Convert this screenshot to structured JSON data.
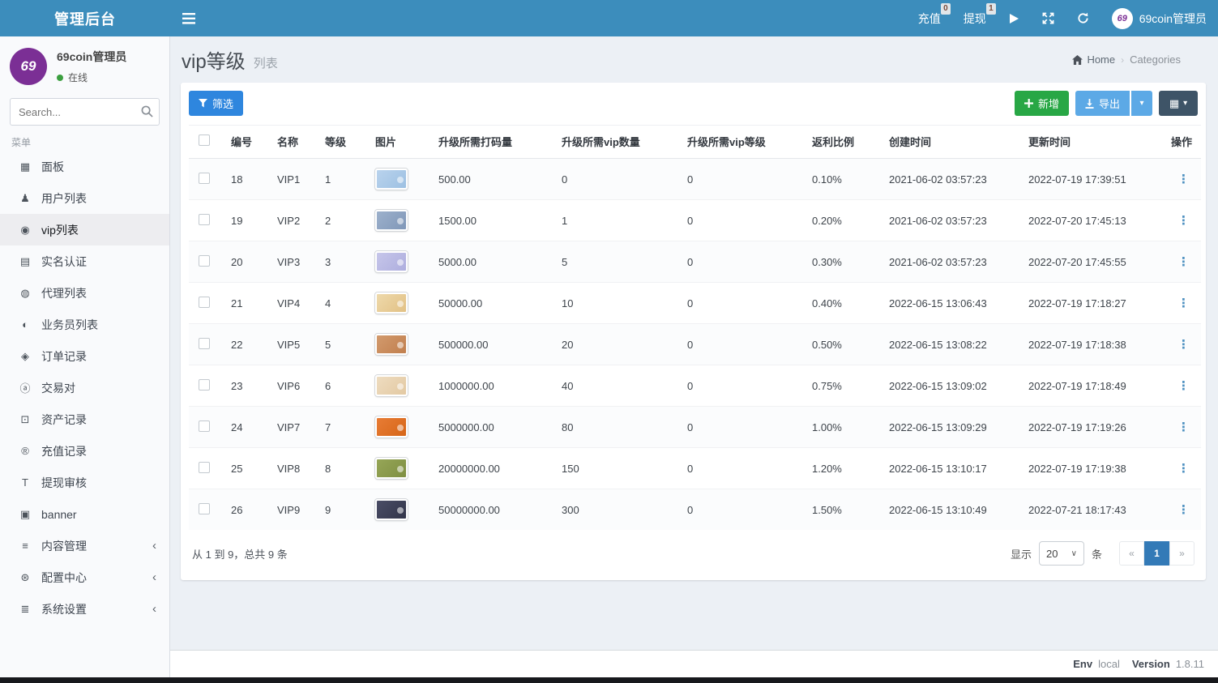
{
  "colors": {
    "navbar_blue": "#3c8dbc",
    "filter_button_blue": "#2e86de",
    "add_button_green": "#28a745",
    "export_button_blue": "#5ca9e6",
    "grid_button_slate": "#3e5467",
    "active_page_blue": "#337ab7",
    "logo_purple": "#7b2f95",
    "online_green": "#3c9f40"
  },
  "navbar": {
    "title": "管理后台",
    "links": [
      {
        "name": "recharge",
        "label": "充值",
        "badge": "0"
      },
      {
        "name": "withdraw",
        "label": "提现",
        "badge": "1"
      }
    ],
    "user_name": "69coin管理员",
    "avatar_text": "69"
  },
  "sidebar": {
    "logo_text": "69",
    "user_name": "69coin管理员",
    "status": "在线",
    "search_placeholder": "Search...",
    "menu_label": "菜单",
    "items": [
      {
        "name": "dashboard",
        "label": "面板",
        "icon": "chart-icon",
        "glyph": "▦"
      },
      {
        "name": "user-list",
        "label": "用户列表",
        "icon": "user-icon",
        "glyph": "♟"
      },
      {
        "name": "vip-list",
        "label": "vip列表",
        "icon": "check-circle-icon",
        "glyph": "◉",
        "active": true
      },
      {
        "name": "real-name-auth",
        "label": "实名认证",
        "icon": "id-card-icon",
        "glyph": "▤"
      },
      {
        "name": "agent-list",
        "label": "代理列表",
        "icon": "agent-circle-icon",
        "glyph": "◍"
      },
      {
        "name": "salesman-list",
        "label": "业务员列表",
        "icon": "adjust-icon",
        "glyph": "◐"
      },
      {
        "name": "order-records",
        "label": "订单记录",
        "icon": "cube-icon",
        "glyph": "◈"
      },
      {
        "name": "trade-pairs",
        "label": "交易对",
        "icon": "letter-a-icon",
        "glyph": "ⓐ"
      },
      {
        "name": "asset-records",
        "label": "资产记录",
        "icon": "money-icon",
        "glyph": "⊡"
      },
      {
        "name": "recharge-records",
        "label": "充值记录",
        "icon": "registered-icon",
        "glyph": "®"
      },
      {
        "name": "withdraw-review",
        "label": "提现审核",
        "icon": "text-height-icon",
        "glyph": "T"
      },
      {
        "name": "banner",
        "label": "banner",
        "icon": "image-icon",
        "glyph": "▣"
      },
      {
        "name": "content-management",
        "label": "内容管理",
        "icon": "bars-icon",
        "glyph": "≡",
        "expandable": true
      },
      {
        "name": "config-center",
        "label": "配置中心",
        "icon": "config-icon",
        "glyph": "⊛",
        "expandable": true
      },
      {
        "name": "system-settings",
        "label": "系统设置",
        "icon": "lines-icon",
        "glyph": "≣",
        "expandable": true
      }
    ]
  },
  "page": {
    "title": "vip等级",
    "subtitle": "列表",
    "breadcrumb_home": "Home",
    "breadcrumb_sep": "›",
    "breadcrumb_current": "Categories"
  },
  "toolbar": {
    "filter_label": "筛选",
    "add_label": "新增",
    "export_label": "导出",
    "grid_glyph": "▦"
  },
  "table": {
    "headers": [
      {
        "key": "id",
        "label": "编号"
      },
      {
        "key": "name",
        "label": "名称"
      },
      {
        "key": "level",
        "label": "等级"
      },
      {
        "key": "image",
        "label": "图片"
      },
      {
        "key": "dama",
        "label": "升级所需打码量"
      },
      {
        "key": "vip-count",
        "label": "升级所需vip数量"
      },
      {
        "key": "vip-level",
        "label": "升级所需vip等级"
      },
      {
        "key": "ratio",
        "label": "返利比例"
      },
      {
        "key": "created",
        "label": "创建时间"
      },
      {
        "key": "updated",
        "label": "更新时间"
      },
      {
        "key": "actions",
        "label": "操作"
      }
    ],
    "rows": [
      {
        "id": "18",
        "name": "VIP1",
        "level": "1",
        "image_from": "#b9d3ed",
        "image_to": "#9dc0e2",
        "dama": "500.00",
        "vip_count": "0",
        "vip_level": "0",
        "ratio": "0.10%",
        "created": "2021-06-02 03:57:23",
        "updated": "2022-07-19 17:39:51"
      },
      {
        "id": "19",
        "name": "VIP2",
        "level": "2",
        "image_from": "#9db1cc",
        "image_to": "#8097b8",
        "dama": "1500.00",
        "vip_count": "1",
        "vip_level": "0",
        "ratio": "0.20%",
        "created": "2021-06-02 03:57:23",
        "updated": "2022-07-20 17:45:13"
      },
      {
        "id": "20",
        "name": "VIP3",
        "level": "3",
        "image_from": "#c6c6ea",
        "image_to": "#aeaede",
        "dama": "5000.00",
        "vip_count": "5",
        "vip_level": "0",
        "ratio": "0.30%",
        "created": "2021-06-02 03:57:23",
        "updated": "2022-07-20 17:45:55"
      },
      {
        "id": "21",
        "name": "VIP4",
        "level": "4",
        "image_from": "#eed9ab",
        "image_to": "#e2c185",
        "dama": "50000.00",
        "vip_count": "10",
        "vip_level": "0",
        "ratio": "0.40%",
        "created": "2022-06-15 13:06:43",
        "updated": "2022-07-19 17:18:27"
      },
      {
        "id": "22",
        "name": "VIP5",
        "level": "5",
        "image_from": "#d29a6d",
        "image_to": "#c17f4e",
        "dama": "500000.00",
        "vip_count": "20",
        "vip_level": "0",
        "ratio": "0.50%",
        "created": "2022-06-15 13:08:22",
        "updated": "2022-07-19 17:18:38"
      },
      {
        "id": "23",
        "name": "VIP6",
        "level": "6",
        "image_from": "#eedcc0",
        "image_to": "#e3c9a2",
        "dama": "1000000.00",
        "vip_count": "40",
        "vip_level": "0",
        "ratio": "0.75%",
        "created": "2022-06-15 13:09:02",
        "updated": "2022-07-19 17:18:49"
      },
      {
        "id": "24",
        "name": "VIP7",
        "level": "7",
        "image_from": "#e87c35",
        "image_to": "#d66618",
        "dama": "5000000.00",
        "vip_count": "80",
        "vip_level": "0",
        "ratio": "1.00%",
        "created": "2022-06-15 13:09:29",
        "updated": "2022-07-19 17:19:26"
      },
      {
        "id": "25",
        "name": "VIP8",
        "level": "8",
        "image_from": "#96a657",
        "image_to": "#7f8f42",
        "dama": "20000000.00",
        "vip_count": "150",
        "vip_level": "0",
        "ratio": "1.20%",
        "created": "2022-06-15 13:10:17",
        "updated": "2022-07-19 17:19:38"
      },
      {
        "id": "26",
        "name": "VIP9",
        "level": "9",
        "image_from": "#4a4d66",
        "image_to": "#32354a",
        "dama": "50000000.00",
        "vip_count": "300",
        "vip_level": "0",
        "ratio": "1.50%",
        "created": "2022-06-15 13:10:49",
        "updated": "2022-07-21 18:17:43"
      }
    ]
  },
  "table_footer": {
    "info": "从 1 到 9，总共 9 条",
    "show_label": "显示",
    "page_size": "20",
    "unit_label": "条",
    "prev_label": "«",
    "page_1": "1",
    "next_label": "»"
  },
  "footer": {
    "env_label": "Env",
    "env_value": "local",
    "version_label": "Version",
    "version_value": "1.8.11"
  }
}
